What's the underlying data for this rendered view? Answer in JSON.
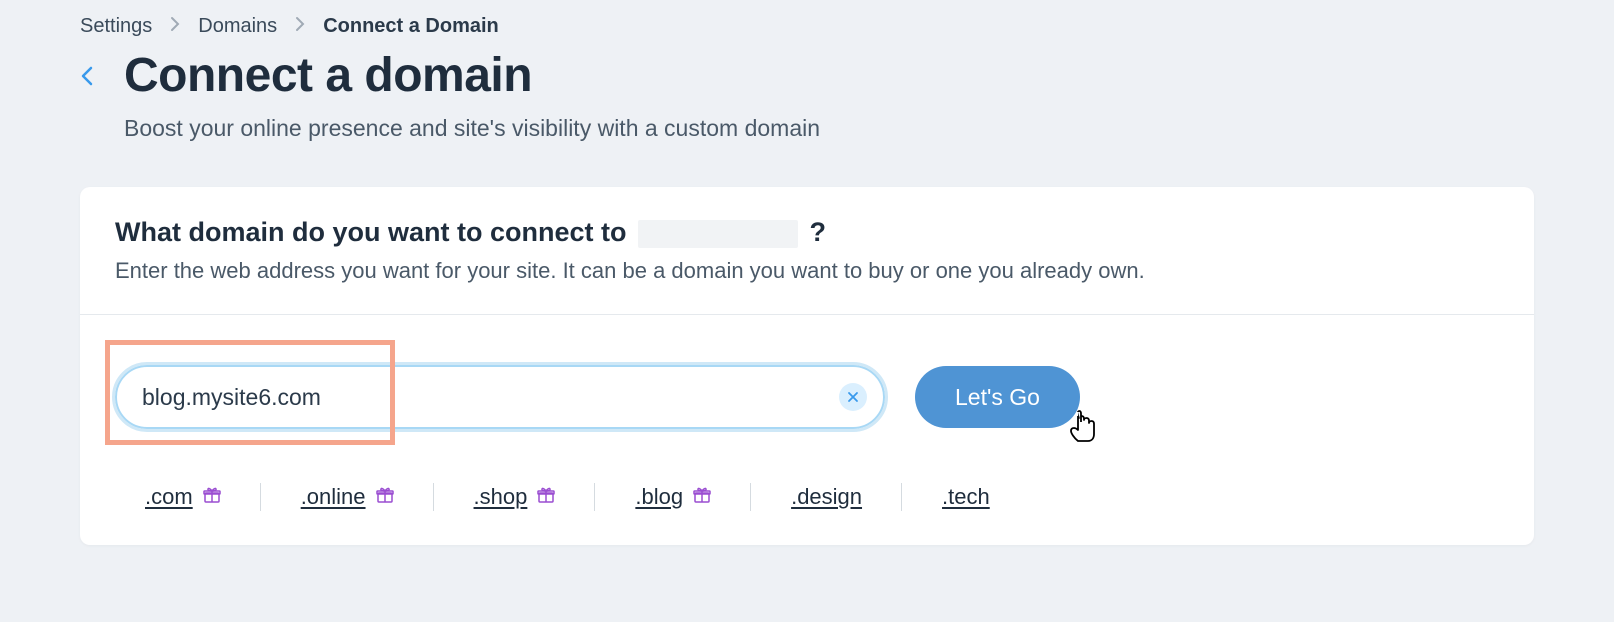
{
  "breadcrumb": {
    "items": [
      "Settings",
      "Domains",
      "Connect a Domain"
    ]
  },
  "header": {
    "title": "Connect a domain",
    "subtitle": "Boost your online presence and site's visibility with a custom domain"
  },
  "card": {
    "heading_prefix": "What domain do you want to connect to",
    "heading_suffix": "?",
    "subheading": "Enter the web address you want for your site. It can be a domain you want to buy or one you already own."
  },
  "form": {
    "domain_value": "blog.mysite6.com",
    "go_label": "Let's Go"
  },
  "tlds": [
    {
      "label": ".com",
      "gift": true
    },
    {
      "label": ".online",
      "gift": true
    },
    {
      "label": ".shop",
      "gift": true
    },
    {
      "label": ".blog",
      "gift": true
    },
    {
      "label": ".design",
      "gift": false
    },
    {
      "label": ".tech",
      "gift": false
    }
  ]
}
